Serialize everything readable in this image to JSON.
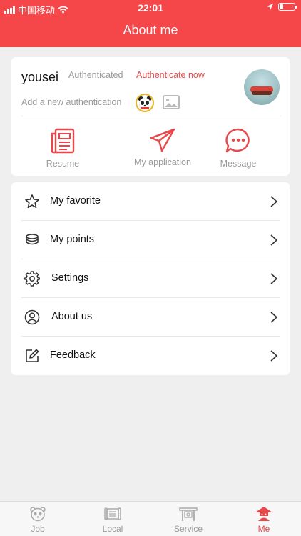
{
  "status_bar": {
    "carrier": "中国移动",
    "time": "22:01"
  },
  "header": {
    "title": "About me",
    "background_color": "#f5474a"
  },
  "profile": {
    "username": "yousei",
    "auth_status": "Authenticated",
    "auth_action": "Authenticate now",
    "add_auth": "Add a new authentication",
    "accent_color": "#e8484b"
  },
  "quick_actions": [
    {
      "label": "Resume",
      "icon": "newspaper-icon"
    },
    {
      "label": "My application",
      "icon": "paper-plane-icon"
    },
    {
      "label": "Message",
      "icon": "chat-bubble-icon"
    }
  ],
  "menu": [
    {
      "label": "My favorite",
      "icon": "star-icon"
    },
    {
      "label": "My points",
      "icon": "coins-stack-icon"
    },
    {
      "label": "Settings",
      "icon": "gear-icon"
    },
    {
      "label": "About us",
      "icon": "user-circle-icon"
    },
    {
      "label": "Feedback",
      "icon": "edit-icon"
    }
  ],
  "tabs": [
    {
      "label": "Job",
      "icon": "panda-icon",
      "active": false
    },
    {
      "label": "Local",
      "icon": "scroll-icon",
      "active": false
    },
    {
      "label": "Service",
      "icon": "gate-icon",
      "active": false
    },
    {
      "label": "Me",
      "icon": "hat-person-icon",
      "active": true
    }
  ]
}
